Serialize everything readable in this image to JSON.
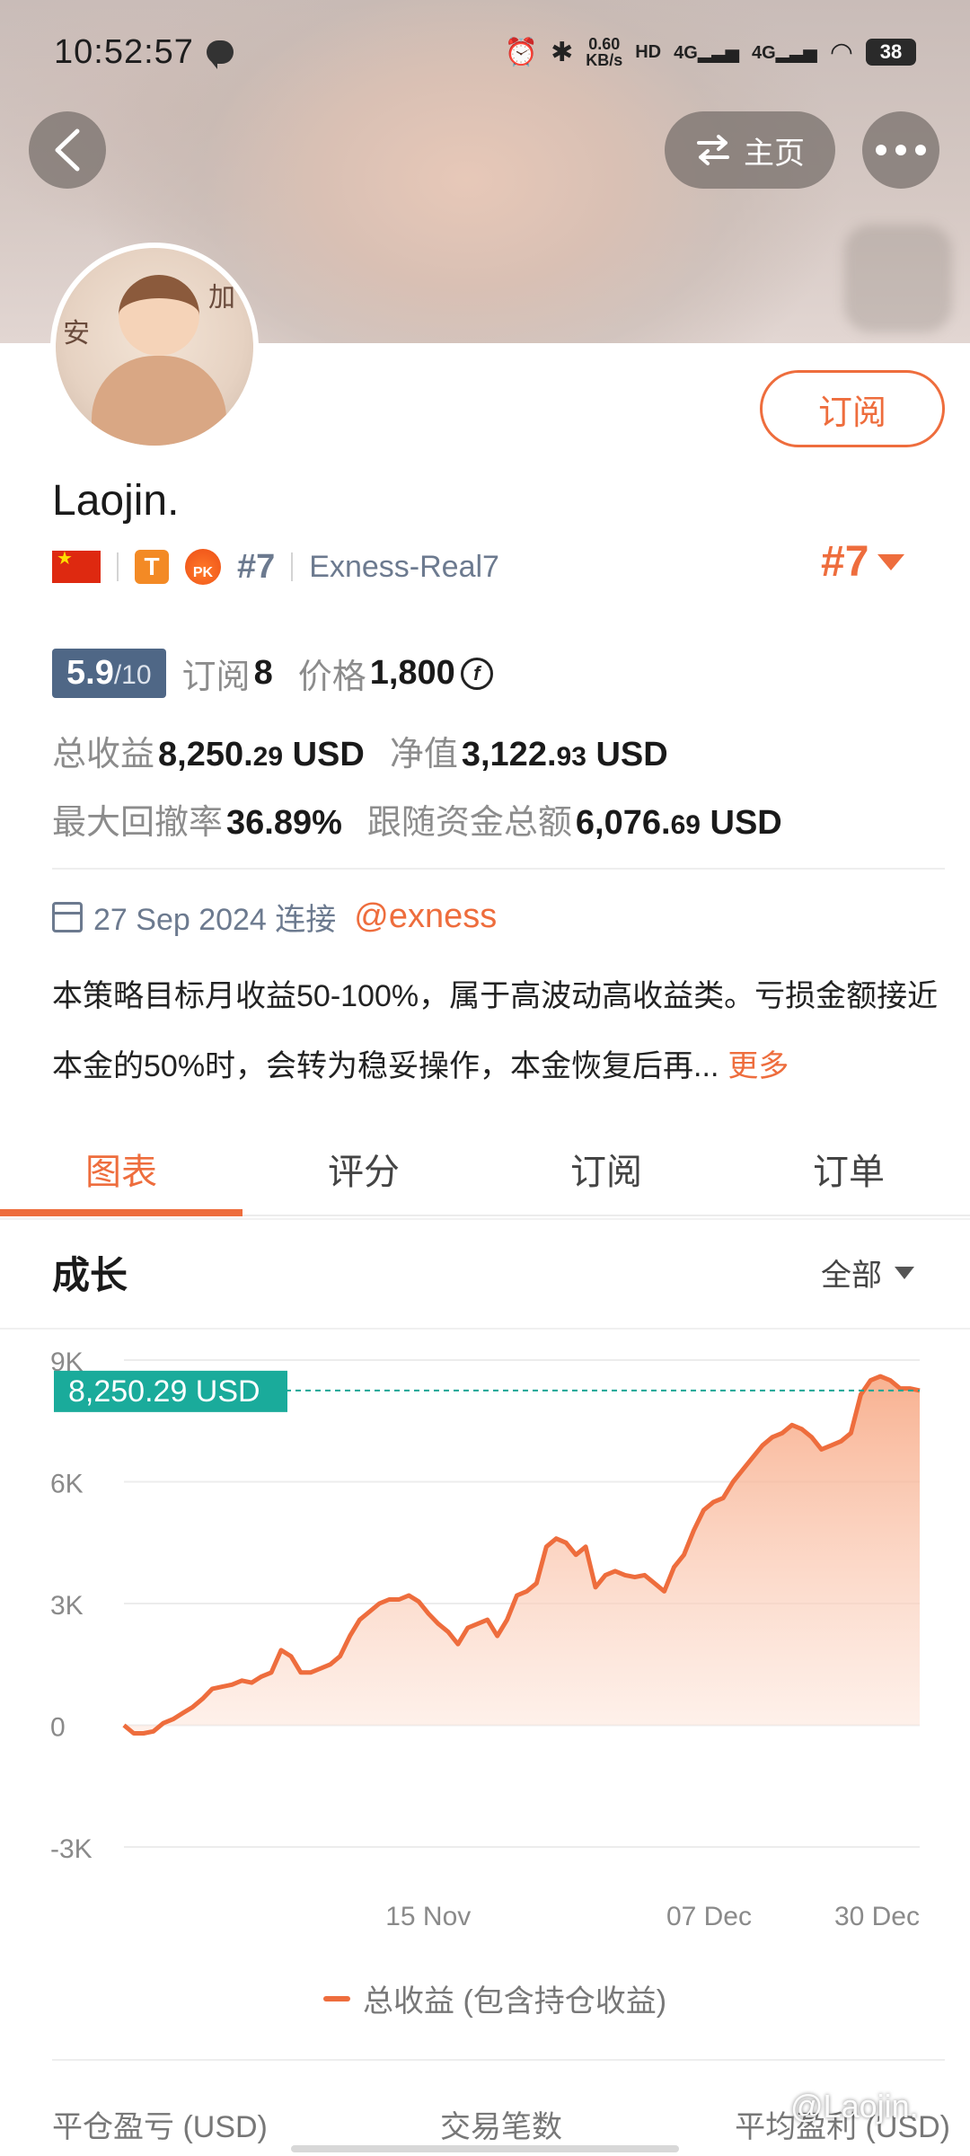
{
  "status_bar": {
    "time": "10:52:57",
    "net_speed_value": "0.60",
    "net_speed_unit": "KB/s",
    "hd_label": "HD",
    "signal_1": "4G",
    "signal_2": "4G",
    "battery": "38"
  },
  "header": {
    "home_label": "主页"
  },
  "profile": {
    "subscribe_label": "订阅",
    "name": "Laojin.",
    "type_badge": "T",
    "pk_badge": "PK",
    "rank_inline": "#7",
    "account": "Exness-Real7",
    "rank_right": "#7"
  },
  "stats": {
    "score": "5.9",
    "score_den": "/10",
    "subscribe_label": "订阅",
    "subscribe_count": "8",
    "price_label": "价格",
    "price_value": "1,800",
    "price_coin": "f",
    "total_profit_label": "总收益",
    "total_profit_int": "8,250.",
    "total_profit_dec": "29",
    "total_profit_unit": "USD",
    "equity_label": "净值",
    "equity_int": "3,122.",
    "equity_dec": "93",
    "equity_unit": "USD",
    "drawdown_label": "最大回撤率",
    "drawdown_value": "36.89%",
    "follow_label": "跟随资金总额",
    "follow_int": "6,076.",
    "follow_dec": "69",
    "follow_unit": "USD"
  },
  "info": {
    "connect_date": "27 Sep 2024 连接",
    "handle": "@exness",
    "description": "本策略目标月收益50-100%，属于高波动高收益类。亏损金额接近本金的50%时，会转为稳妥操作，本金恢复后再...",
    "more_label": "更多"
  },
  "tabs": [
    {
      "label": "图表",
      "active": true
    },
    {
      "label": "评分",
      "active": false
    },
    {
      "label": "订阅",
      "active": false
    },
    {
      "label": "订单",
      "active": false
    }
  ],
  "growth": {
    "title": "成长",
    "range_label": "全部"
  },
  "chart_data": {
    "type": "area",
    "current_label": "8,250.29 USD",
    "current_value": 8250.29,
    "ylim": [
      -3000,
      9000
    ],
    "yticks": [
      {
        "label": "9K",
        "value": 9000
      },
      {
        "label": "6K",
        "value": 6000
      },
      {
        "label": "3K",
        "value": 3000
      },
      {
        "label": "0",
        "value": 0
      },
      {
        "label": "-3K",
        "value": -3000
      }
    ],
    "xticks": [
      {
        "label": "15 Nov",
        "index": 39
      },
      {
        "label": "07 Dec",
        "index": 75
      },
      {
        "label": "30 Dec",
        "index": 102
      }
    ],
    "grid": true,
    "series": [
      {
        "name": "总收益 (包含持仓收益)",
        "color": "#ee6d3d",
        "values": [
          0,
          -200,
          -200,
          -150,
          50,
          150,
          300,
          450,
          650,
          900,
          950,
          1000,
          1100,
          1050,
          1200,
          1300,
          1850,
          1700,
          1300,
          1300,
          1400,
          1500,
          1700,
          2200,
          2600,
          2800,
          3000,
          3100,
          3100,
          3200,
          3050,
          2750,
          2500,
          2300,
          2000,
          2400,
          2500,
          2600,
          2200,
          2600,
          3200,
          3300,
          3500,
          4400,
          4600,
          4500,
          4200,
          4400,
          3400,
          3700,
          3800,
          3700,
          3650,
          3700,
          3500,
          3300,
          3900,
          4200,
          4800,
          5300,
          5500,
          5600,
          6000,
          6300,
          6600,
          6900,
          7100,
          7200,
          7400,
          7300,
          7100,
          6800,
          6900,
          7000,
          7200,
          8150,
          8500,
          8600,
          8500,
          8300,
          8300,
          8250
        ]
      }
    ],
    "legend_position": "bottom"
  },
  "bottom_headers": [
    "平仓盈亏 (USD)",
    "交易笔数",
    "平均盈利 (USD)"
  ],
  "watermark": "@Laojin."
}
